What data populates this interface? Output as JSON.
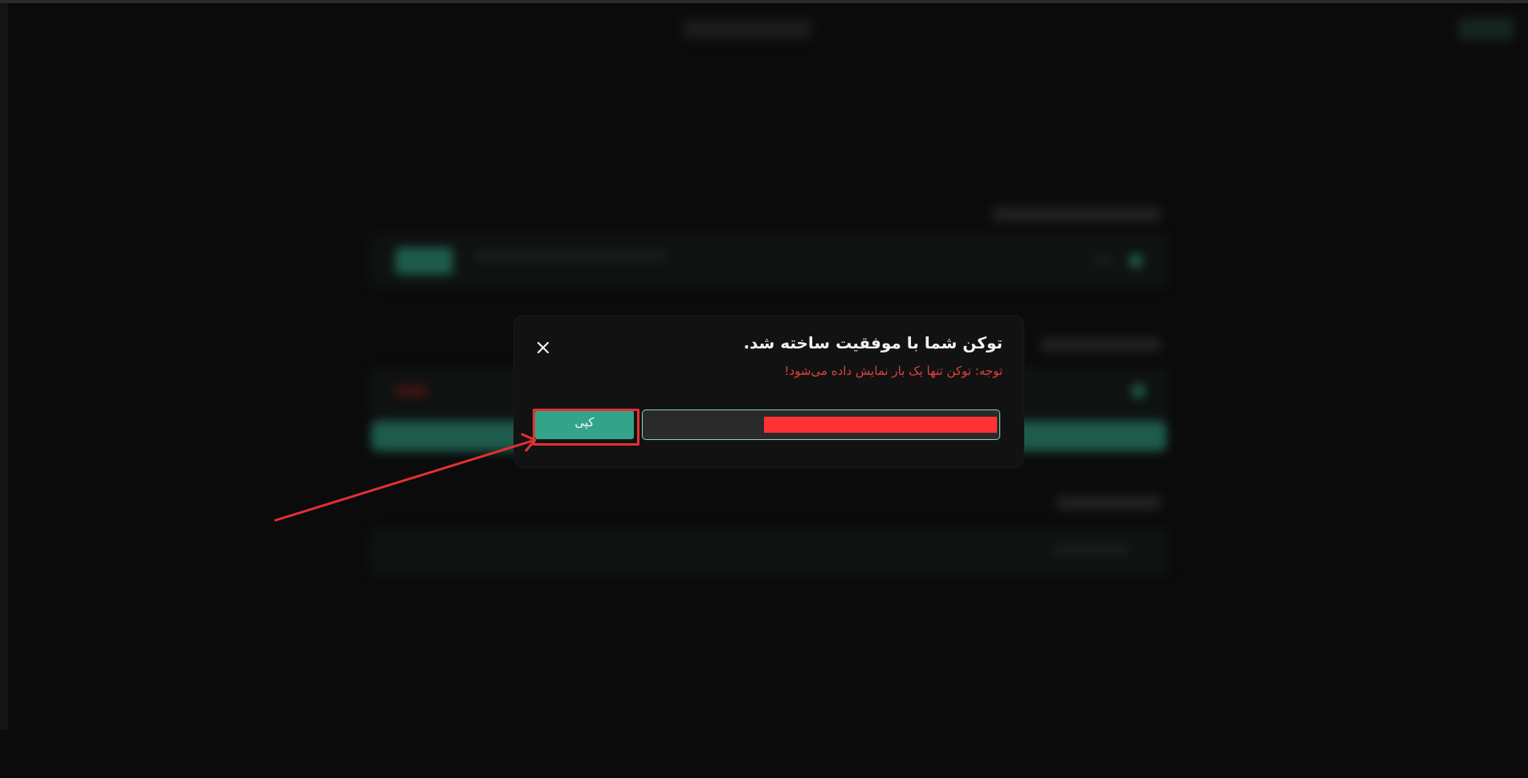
{
  "modal": {
    "title": "توکن شما با موفقیت ساخته شد.",
    "warning": "توجه: توکن تنها یک بار نمایش داده می‌شود!",
    "copy_label": "کپی",
    "close_icon": "close-icon"
  },
  "colors": {
    "background": "#0b0b0b",
    "modal_bg": "#121212",
    "accent": "#33a38a",
    "warning": "#e04040",
    "annotation": "#e53030",
    "redaction": "#ff3333"
  }
}
